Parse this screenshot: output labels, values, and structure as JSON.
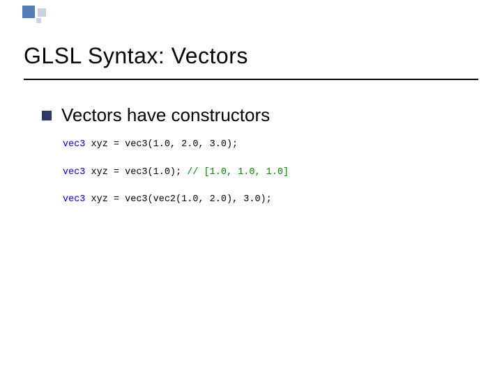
{
  "title": "GLSL Syntax:  Vectors",
  "bullet": "Vectors have constructors",
  "code": [
    {
      "kw": "vec3",
      "rest": " xyz = vec3(1.0, 2.0, 3.0);"
    },
    {
      "kw": "vec3",
      "rest": " xyz = vec3(1.0); ",
      "comment": "// [1.0, 1.0, 1.0]"
    },
    {
      "kw": "vec3",
      "rest": " xyz = vec3(vec2(1.0, 2.0), 3.0);"
    }
  ]
}
